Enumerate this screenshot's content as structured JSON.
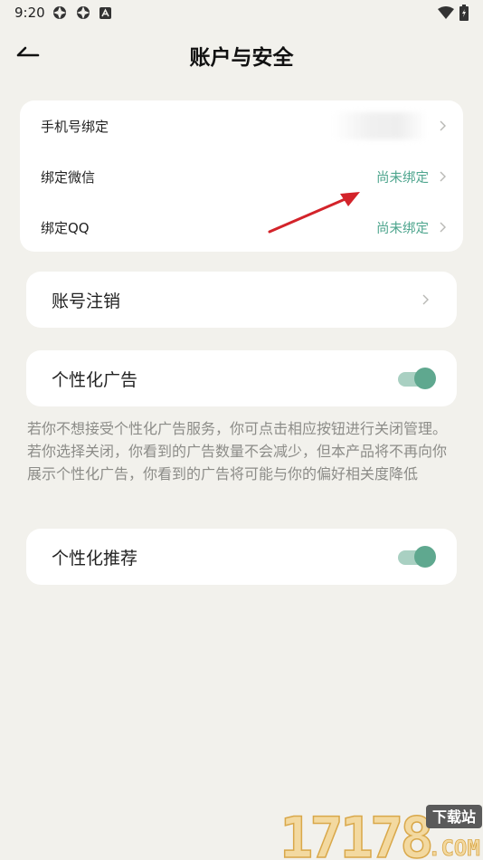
{
  "status_bar": {
    "time": "9:20"
  },
  "header": {
    "title": "账户与安全"
  },
  "binding_card": {
    "rows": [
      {
        "label": "手机号绑定",
        "value": ""
      },
      {
        "label": "绑定微信",
        "value": "尚未绑定"
      },
      {
        "label": "绑定QQ",
        "value": "尚未绑定"
      }
    ]
  },
  "account_cancel": {
    "label": "账号注销"
  },
  "personalized_ads": {
    "label": "个性化广告",
    "enabled": true,
    "description": "若你不想接受个性化广告服务，你可点击相应按钮进行关闭管理。若你选择关闭，你看到的广告数量不会减少，但本产品将不再向你展示个性化广告，你看到的广告将可能与你的偏好相关度降低"
  },
  "personalized_recommend": {
    "label": "个性化推荐",
    "enabled": true
  },
  "watermark": {
    "number": "17178",
    "tag": "下载站",
    "domain": ".COM"
  },
  "colors": {
    "background": "#f2f1ec",
    "card": "#ffffff",
    "accent": "#5fa88f",
    "value_text": "#4ea58e",
    "annotation_arrow": "#d3232a"
  }
}
